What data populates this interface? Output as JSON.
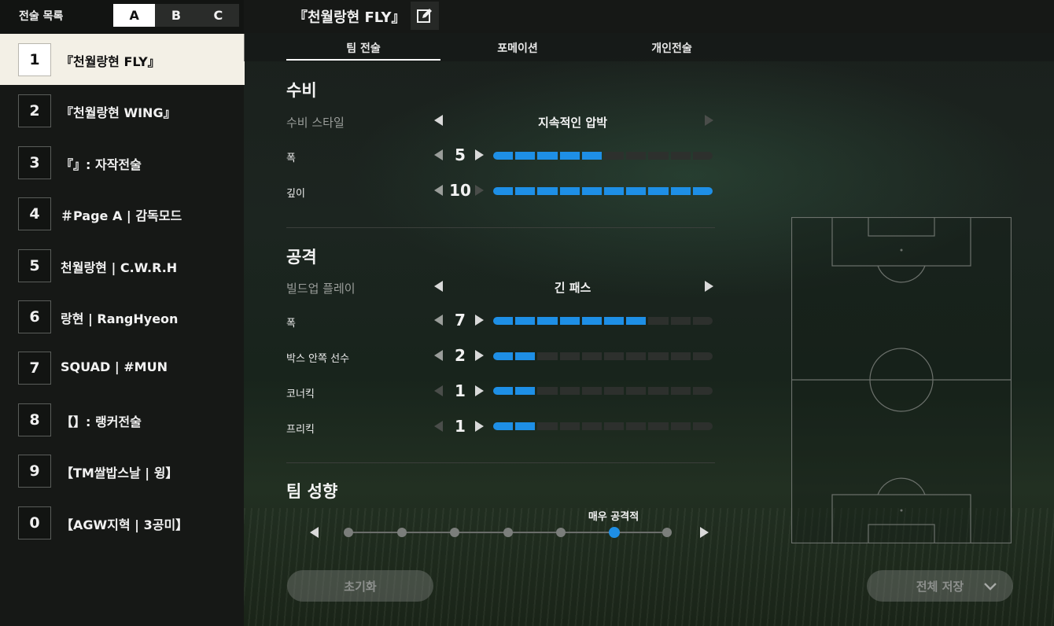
{
  "left_panel": {
    "title": "전술 목록",
    "pages": [
      "A",
      "B",
      "C"
    ],
    "active_page": "A",
    "tactics": [
      {
        "num": "1",
        "name": "『천월랑현 FLY』",
        "active": true
      },
      {
        "num": "2",
        "name": "『천월랑현 WING』"
      },
      {
        "num": "3",
        "name": "『』: 자작전술"
      },
      {
        "num": "4",
        "name": "＃Page A | 감독모드"
      },
      {
        "num": "5",
        "name": "천월랑현 | C.W.R.H"
      },
      {
        "num": "6",
        "name": "랑현 | RangHyeon"
      },
      {
        "num": "7",
        "name": "SQUAD | #MUN"
      },
      {
        "num": "8",
        "name": "【】: 랭커전술"
      },
      {
        "num": "9",
        "name": "【TM쌀밥스날 | 윙】"
      },
      {
        "num": "0",
        "name": "【AGW지혁 | 3공미】"
      }
    ]
  },
  "header": {
    "title": "『천월랑현 FLY』",
    "edit_icon": "pencil-edit-icon"
  },
  "tabs": [
    {
      "label": "팀 전술",
      "active": true
    },
    {
      "label": "포메이션"
    },
    {
      "label": "개인전술"
    }
  ],
  "defense": {
    "title": "수비",
    "style_label": "수비 스타일",
    "style_value": "지속적인 압박",
    "rows": [
      {
        "label": "폭",
        "value": 5,
        "max": 10
      },
      {
        "label": "깊이",
        "value": 10,
        "max": 10
      }
    ]
  },
  "attack": {
    "title": "공격",
    "style_label": "빌드업 플레이",
    "style_value": "긴 패스",
    "rows": [
      {
        "label": "폭",
        "value": 7,
        "max": 10
      },
      {
        "label": "박스 안쪽 선수",
        "value": 2,
        "max": 10
      },
      {
        "label": "코너킥",
        "value": 1,
        "max": 5
      },
      {
        "label": "프리킥",
        "value": 1,
        "max": 5
      }
    ]
  },
  "team_tendency": {
    "title": "팀 성향",
    "value_label": "매우 공격적",
    "steps": 7,
    "selected_index": 5
  },
  "buttons": {
    "reset": "초기화",
    "save_all": "전체 저장"
  },
  "colors": {
    "accent": "#1e8fe6",
    "active_item_bg": "#f3f0e6"
  }
}
